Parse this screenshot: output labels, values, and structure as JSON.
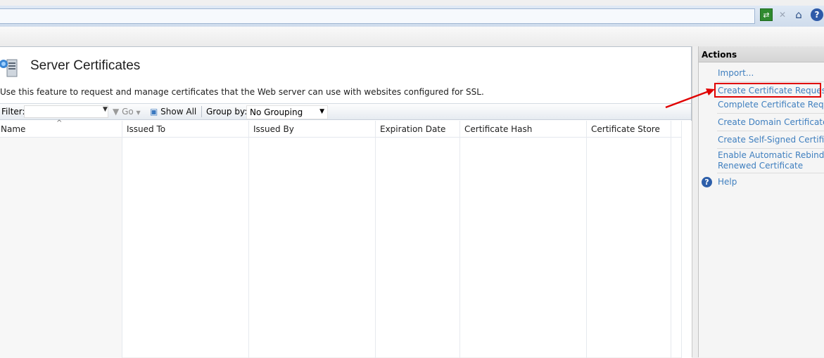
{
  "toolbar": {
    "address_value": "",
    "icons": [
      "refresh-icon",
      "stop-icon",
      "home-icon",
      "help-icon"
    ],
    "home_glyph": "⌂",
    "help_glyph": "?",
    "refresh_glyph": "⇄",
    "stop_glyph": "✕"
  },
  "main": {
    "title": "Server Certificates",
    "description": "Use this feature to request and manage certificates that the Web server can use with websites configured for SSL.",
    "filter_bar": {
      "filter_label": "Filter:",
      "filter_value": "",
      "go_label": "Go",
      "show_all_label": "Show All",
      "group_by_label": "Group by:",
      "group_by_value": "No Grouping"
    },
    "columns": [
      "Name",
      "Issued To",
      "Issued By",
      "Expiration Date",
      "Certificate Hash",
      "Certificate Store"
    ],
    "rows": []
  },
  "actions": {
    "header": "Actions",
    "items": [
      {
        "label": "Import..."
      },
      {
        "label": "Create Certificate Request..."
      },
      {
        "label": "Complete Certificate Request"
      },
      {
        "label": "Create Domain Certificate..."
      },
      {
        "label": "Create Self-Signed Certificate"
      },
      {
        "label": "Enable Automatic Rebind of",
        "label2": "Renewed Certificate"
      },
      {
        "label": "Help"
      }
    ],
    "highlighted_item": "Create Certificate Request...",
    "highlight_color": "#e00000",
    "link_color": "#3f7fbf"
  }
}
